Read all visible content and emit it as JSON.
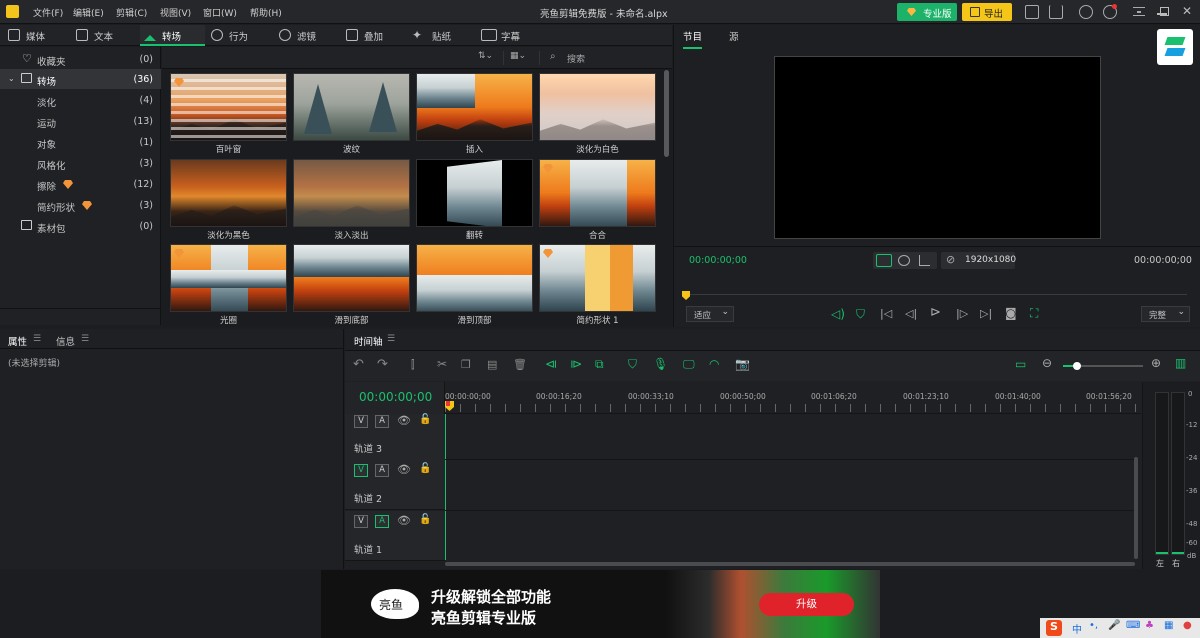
{
  "titlebar": {
    "menus": [
      "文件(F)",
      "编辑(E)",
      "剪辑(C)",
      "视图(V)",
      "窗口(W)",
      "帮助(H)"
    ],
    "title": "亮鱼剪辑免费版 - 未命名.alpx",
    "pro_label": "专业版",
    "export_label": "导出"
  },
  "tabs": [
    "媒体",
    "文本",
    "转场",
    "行为",
    "滤镜",
    "叠加",
    "贴纸",
    "字幕"
  ],
  "tree": [
    {
      "label": "收藏夹",
      "count": "(0)"
    },
    {
      "label": "转场",
      "count": "(36)"
    },
    {
      "label": "淡化",
      "count": "(4)"
    },
    {
      "label": "运动",
      "count": "(13)"
    },
    {
      "label": "对象",
      "count": "(1)"
    },
    {
      "label": "风格化",
      "count": "(3)"
    },
    {
      "label": "擦除",
      "count": "(12)"
    },
    {
      "label": "简约形状",
      "count": "(3)"
    },
    {
      "label": "素材包",
      "count": "(0)"
    }
  ],
  "search_placeholder": "搜索",
  "thumbs": [
    "百叶窗",
    "波纹",
    "插入",
    "淡化为白色",
    "淡化为黑色",
    "淡入淡出",
    "翻转",
    "合合",
    "光圈",
    "滑到底部",
    "滑到顶部",
    "简约形状 1"
  ],
  "preview": {
    "tab1": "节目",
    "tab2": "源",
    "time_left": "00:00:00;00",
    "time_right": "00:00:00;00",
    "resolution": "1920x1080",
    "fit": "适应",
    "quality": "完整"
  },
  "props": {
    "tab1": "属性",
    "tab2": "信息",
    "empty": "(未选择剪辑)"
  },
  "timeline": {
    "tab": "时间轴",
    "timecode": "00:00:00;00",
    "ruler": [
      "00:00:00;00",
      "00:00:16;20",
      "00:00:33;10",
      "00:00:50;00",
      "00:01:06;20",
      "00:01:23;10",
      "00:01:40;00",
      "00:01:56;20"
    ],
    "tracks": [
      "轨道 3",
      "轨道 2",
      "轨道 1"
    ],
    "meter": [
      "0",
      "-12",
      "-24",
      "-36",
      "-48",
      "-60",
      "dB"
    ],
    "lr": [
      "左",
      "右"
    ]
  },
  "ad": {
    "logo": "亮鱼",
    "line1": "升级解锁全部功能",
    "line2": "亮鱼剪辑专业版",
    "button": "升级"
  },
  "taskbar": {
    "ime": "中"
  }
}
